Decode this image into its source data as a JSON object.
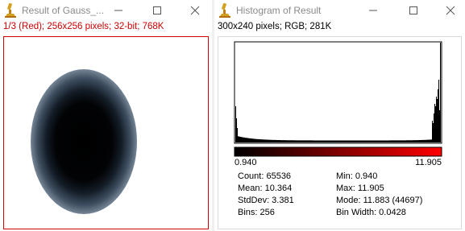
{
  "left_window": {
    "title": "Result of Gauss_...",
    "info": "1/3 (Red); 256x256 pixels; 32-bit; 768K"
  },
  "right_window": {
    "title": "Histogram of Result",
    "info": "300x240 pixels; RGB; 281K",
    "histogram": {
      "min_label": "0.940",
      "max_label": "11.905",
      "gradient_colors": [
        "#000000",
        "#ff0000"
      ]
    },
    "stats": {
      "count": "Count: 65536",
      "mean": "Mean: 10.364",
      "stddev": "StdDev: 3.381",
      "bins": "Bins: 256",
      "min": "Min: 0.940",
      "max": "Max: 11.905",
      "mode": "Mode: 11.883 (44697)",
      "bin_width": "Bin Width: 0.0428"
    }
  },
  "colors": {
    "accent_red": "#cc0000",
    "title_gray": "#8a8a8a"
  },
  "icons": [
    "imagej-microscope-icon",
    "minimize-icon",
    "maximize-icon",
    "close-icon"
  ]
}
